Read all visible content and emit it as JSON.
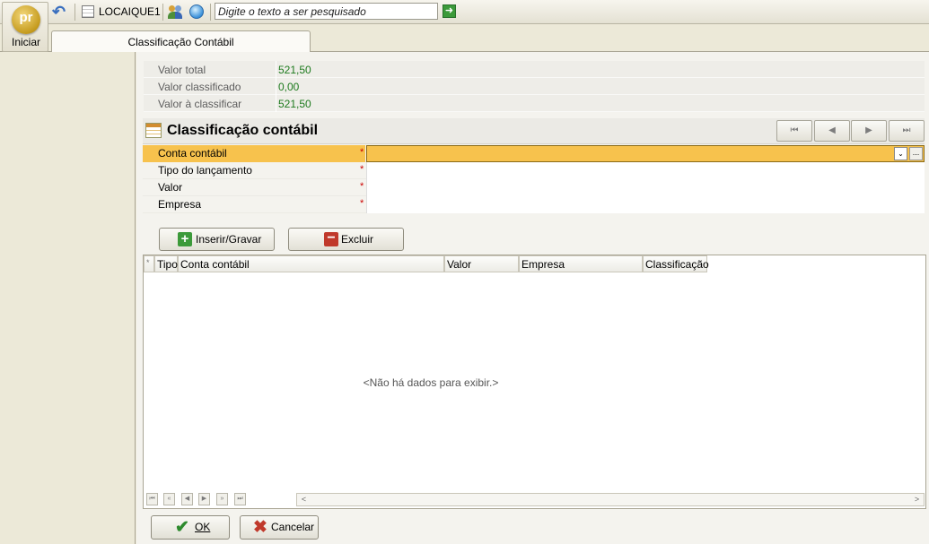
{
  "start": {
    "logo": "pr",
    "label": "Iniciar"
  },
  "toolbar": {
    "company": "LOCAIQUE1",
    "search_placeholder": "Digite o texto a ser pesquisado",
    "go_symbol": "➜"
  },
  "tab": {
    "label": "Classificação Contábil"
  },
  "summary": [
    {
      "label": "Valor total",
      "value": "521,50"
    },
    {
      "label": "Valor classificado",
      "value": "0,00"
    },
    {
      "label": "Valor à classificar",
      "value": "521,50"
    }
  ],
  "section": {
    "title": "Classificação contábil",
    "nav": {
      "first": "⏮",
      "prev": "◀",
      "next": "▶",
      "last": "⏭"
    }
  },
  "form": {
    "fields": [
      {
        "label": "Conta contábil",
        "required": "*"
      },
      {
        "label": "Tipo do lançamento",
        "required": "*"
      },
      {
        "label": "Valor",
        "required": "*"
      },
      {
        "label": "Empresa",
        "required": "*"
      }
    ],
    "dropdown_symbol": "⌄",
    "ellipsis_symbol": "..."
  },
  "actions": {
    "insert": "Inserir/Gravar",
    "delete": "Excluir"
  },
  "grid": {
    "columns": [
      "*",
      "Tipo",
      "Conta contábil",
      "Valor",
      "Empresa",
      "Classificação"
    ],
    "empty_message": "<Não há dados para exibir.>",
    "nav": [
      "⏮",
      "«",
      "◀",
      "▶",
      "»",
      "⏭"
    ],
    "scroll_left": "<",
    "scroll_right": ">"
  },
  "footer": {
    "ok": "OK",
    "cancel": "Cancelar"
  },
  "icons": {
    "undo": "undo-icon",
    "company": "grid-icon",
    "users": "users-icon",
    "globe": "globe-icon",
    "go": "arrow-right-icon",
    "check": "check-icon",
    "close": "close-icon"
  },
  "colors": {
    "accent": "#f7c24d",
    "value_green": "#1d7a1d",
    "required": "#cc0000"
  }
}
